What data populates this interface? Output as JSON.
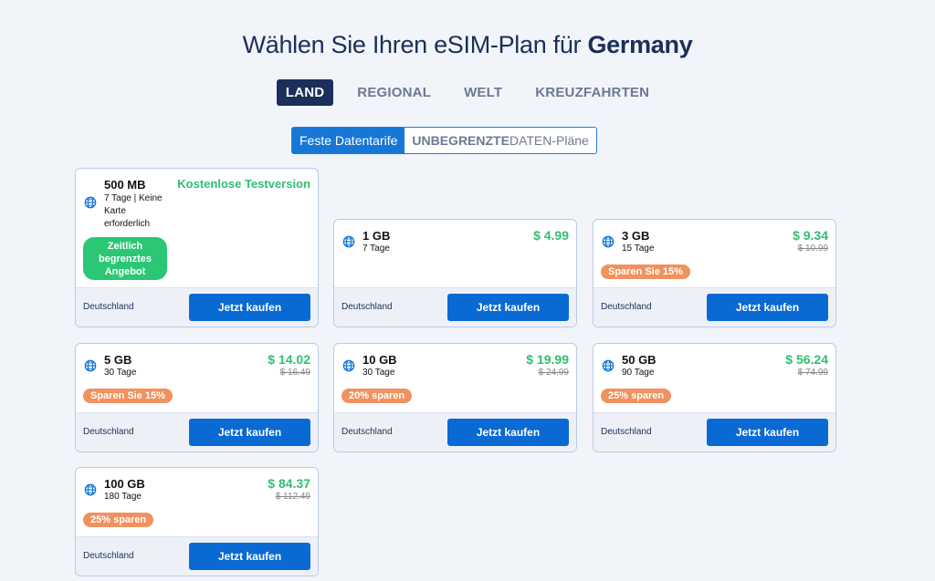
{
  "header": {
    "title_prefix": "Wählen Sie Ihren eSIM-Plan für ",
    "title_country": "Germany"
  },
  "tabs": [
    {
      "label": "LAND",
      "active": true
    },
    {
      "label": "REGIONAL",
      "active": false
    },
    {
      "label": "WELT",
      "active": false
    },
    {
      "label": "KREUZFAHRTEN",
      "active": false
    }
  ],
  "toggle": {
    "fixed_label": "Feste Datentarife",
    "unlimited_bold": "UNBEGRENZTE",
    "unlimited_rest": " DATEN-Pläne"
  },
  "colors": {
    "accent": "#1677d7",
    "price_green": "#2fbf71",
    "badge_orange": "#f0925f",
    "navy": "#1b2f5a"
  },
  "icons": {
    "plan": "globe-icon"
  },
  "plans": [
    {
      "size": "500 MB",
      "days_lines": [
        "7 Tage | Keine",
        "Karte",
        "erforderlich"
      ],
      "trial_label": "Kostenlose Testversion",
      "promo_lines": [
        "Zeitlich",
        "begrenztes",
        "Angebot"
      ],
      "country": "Deutschland",
      "buy_label": "Jetzt kaufen"
    },
    {
      "size": "1 GB",
      "days": "7 Tage",
      "price": "$ 4.99",
      "country": "Deutschland",
      "buy_label": "Jetzt kaufen"
    },
    {
      "size": "3 GB",
      "days": "15 Tage",
      "price": "$ 9.34",
      "old_price": "$ 10.99",
      "badge": "Sparen Sie 15%",
      "country": "Deutschland",
      "buy_label": "Jetzt kaufen"
    },
    {
      "size": "5 GB",
      "days": "30 Tage",
      "price": "$ 14.02",
      "old_price": "$ 16.49",
      "badge": "Sparen Sie 15%",
      "country": "Deutschland",
      "buy_label": "Jetzt kaufen"
    },
    {
      "size": "10 GB",
      "days": "30 Tage",
      "price": "$ 19.99",
      "old_price": "$ 24.99",
      "badge": "20% sparen",
      "country": "Deutschland",
      "buy_label": "Jetzt kaufen"
    },
    {
      "size": "50 GB",
      "days": "90 Tage",
      "price": "$ 56.24",
      "old_price": "$ 74.99",
      "badge": "25% sparen",
      "country": "Deutschland",
      "buy_label": "Jetzt kaufen"
    },
    {
      "size": "100 GB",
      "days": "180 Tage",
      "price": "$ 84.37",
      "old_price": "$ 112.49",
      "badge": "25% sparen",
      "country": "Deutschland",
      "buy_label": "Jetzt kaufen"
    }
  ]
}
